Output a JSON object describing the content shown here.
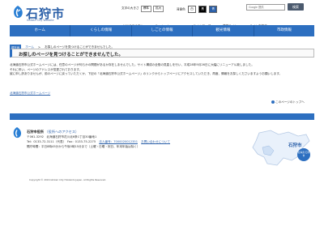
{
  "header": {
    "site_name": "石狩市",
    "site_sub": "Ishikari City Website",
    "text_size_label": "文字の大きさ",
    "text_size_options": [
      "標準",
      "拡大"
    ],
    "bg_color_label": "背景色",
    "bg_color_options": [
      "白",
      "黒",
      "青"
    ],
    "search_placeholder": "Google 提供",
    "search_button": "検索",
    "utility_links": [
      "はじめての方へ",
      "Foreign language",
      "サイトマップ",
      "携帯サイト",
      "サイト内検索"
    ]
  },
  "nav": [
    "ホーム",
    "くらしの情報",
    "しごとの情報",
    "観光情報",
    "市政情報"
  ],
  "breadcrumb": {
    "label": "現在地",
    "home": "ホーム",
    "sep": ">",
    "current": "お探しのページを見つけることができませんでした。"
  },
  "page_title": "お探しのページを見つけることができませんでした。",
  "body_lines": [
    "北海道石狩市公式ホームページには、任意のページが何らかの問題があるか存在しませんでした。サイト構成の全般の見直しを行い、平成28年9月26日に大幅にリニューアル致しました。",
    "それに伴い、ページのアドレスが変更されております。",
    "誠に申し訳ありませんが、前のページに戻っていただくか、下記の「北海道石狩市公式ホームページ」のリンクからトップページにアクセスしていただき、再度、情報をお探しくださいますようお願いします。"
  ],
  "top_link": "北海道石狩市公式ホームページ",
  "pagetop": "このページのトップへ",
  "footer_nav": [
    "リンク・著作権・免責事項",
    "個人情報保護",
    "アクセシビリティ"
  ],
  "footer": {
    "office": "石狩市役所",
    "office_link": "（役所へのアクセス）",
    "address": "〒061-3292　北海道石狩市花川北6条1丁目30番地1",
    "phone": "Tel：0133-72-3111（代表）　Fax：0133-75-2275",
    "corp_no": "法人番号：7000020012351",
    "inquiry": "お問い合わせについて",
    "hours": "開庁時間：平日8時45分から午後5時15分まで（土曜・日曜・祝日、年末年始は除く）",
    "map_label": "石狩市",
    "map_badge": "北海道 石狩市",
    "copyright": "Copyright © 2016 Ishikari City Hokkaido Japan. All Rights Reserved."
  },
  "colors": {
    "brand": "#2d6fc0",
    "brand_dark": "#2a5fa8"
  }
}
